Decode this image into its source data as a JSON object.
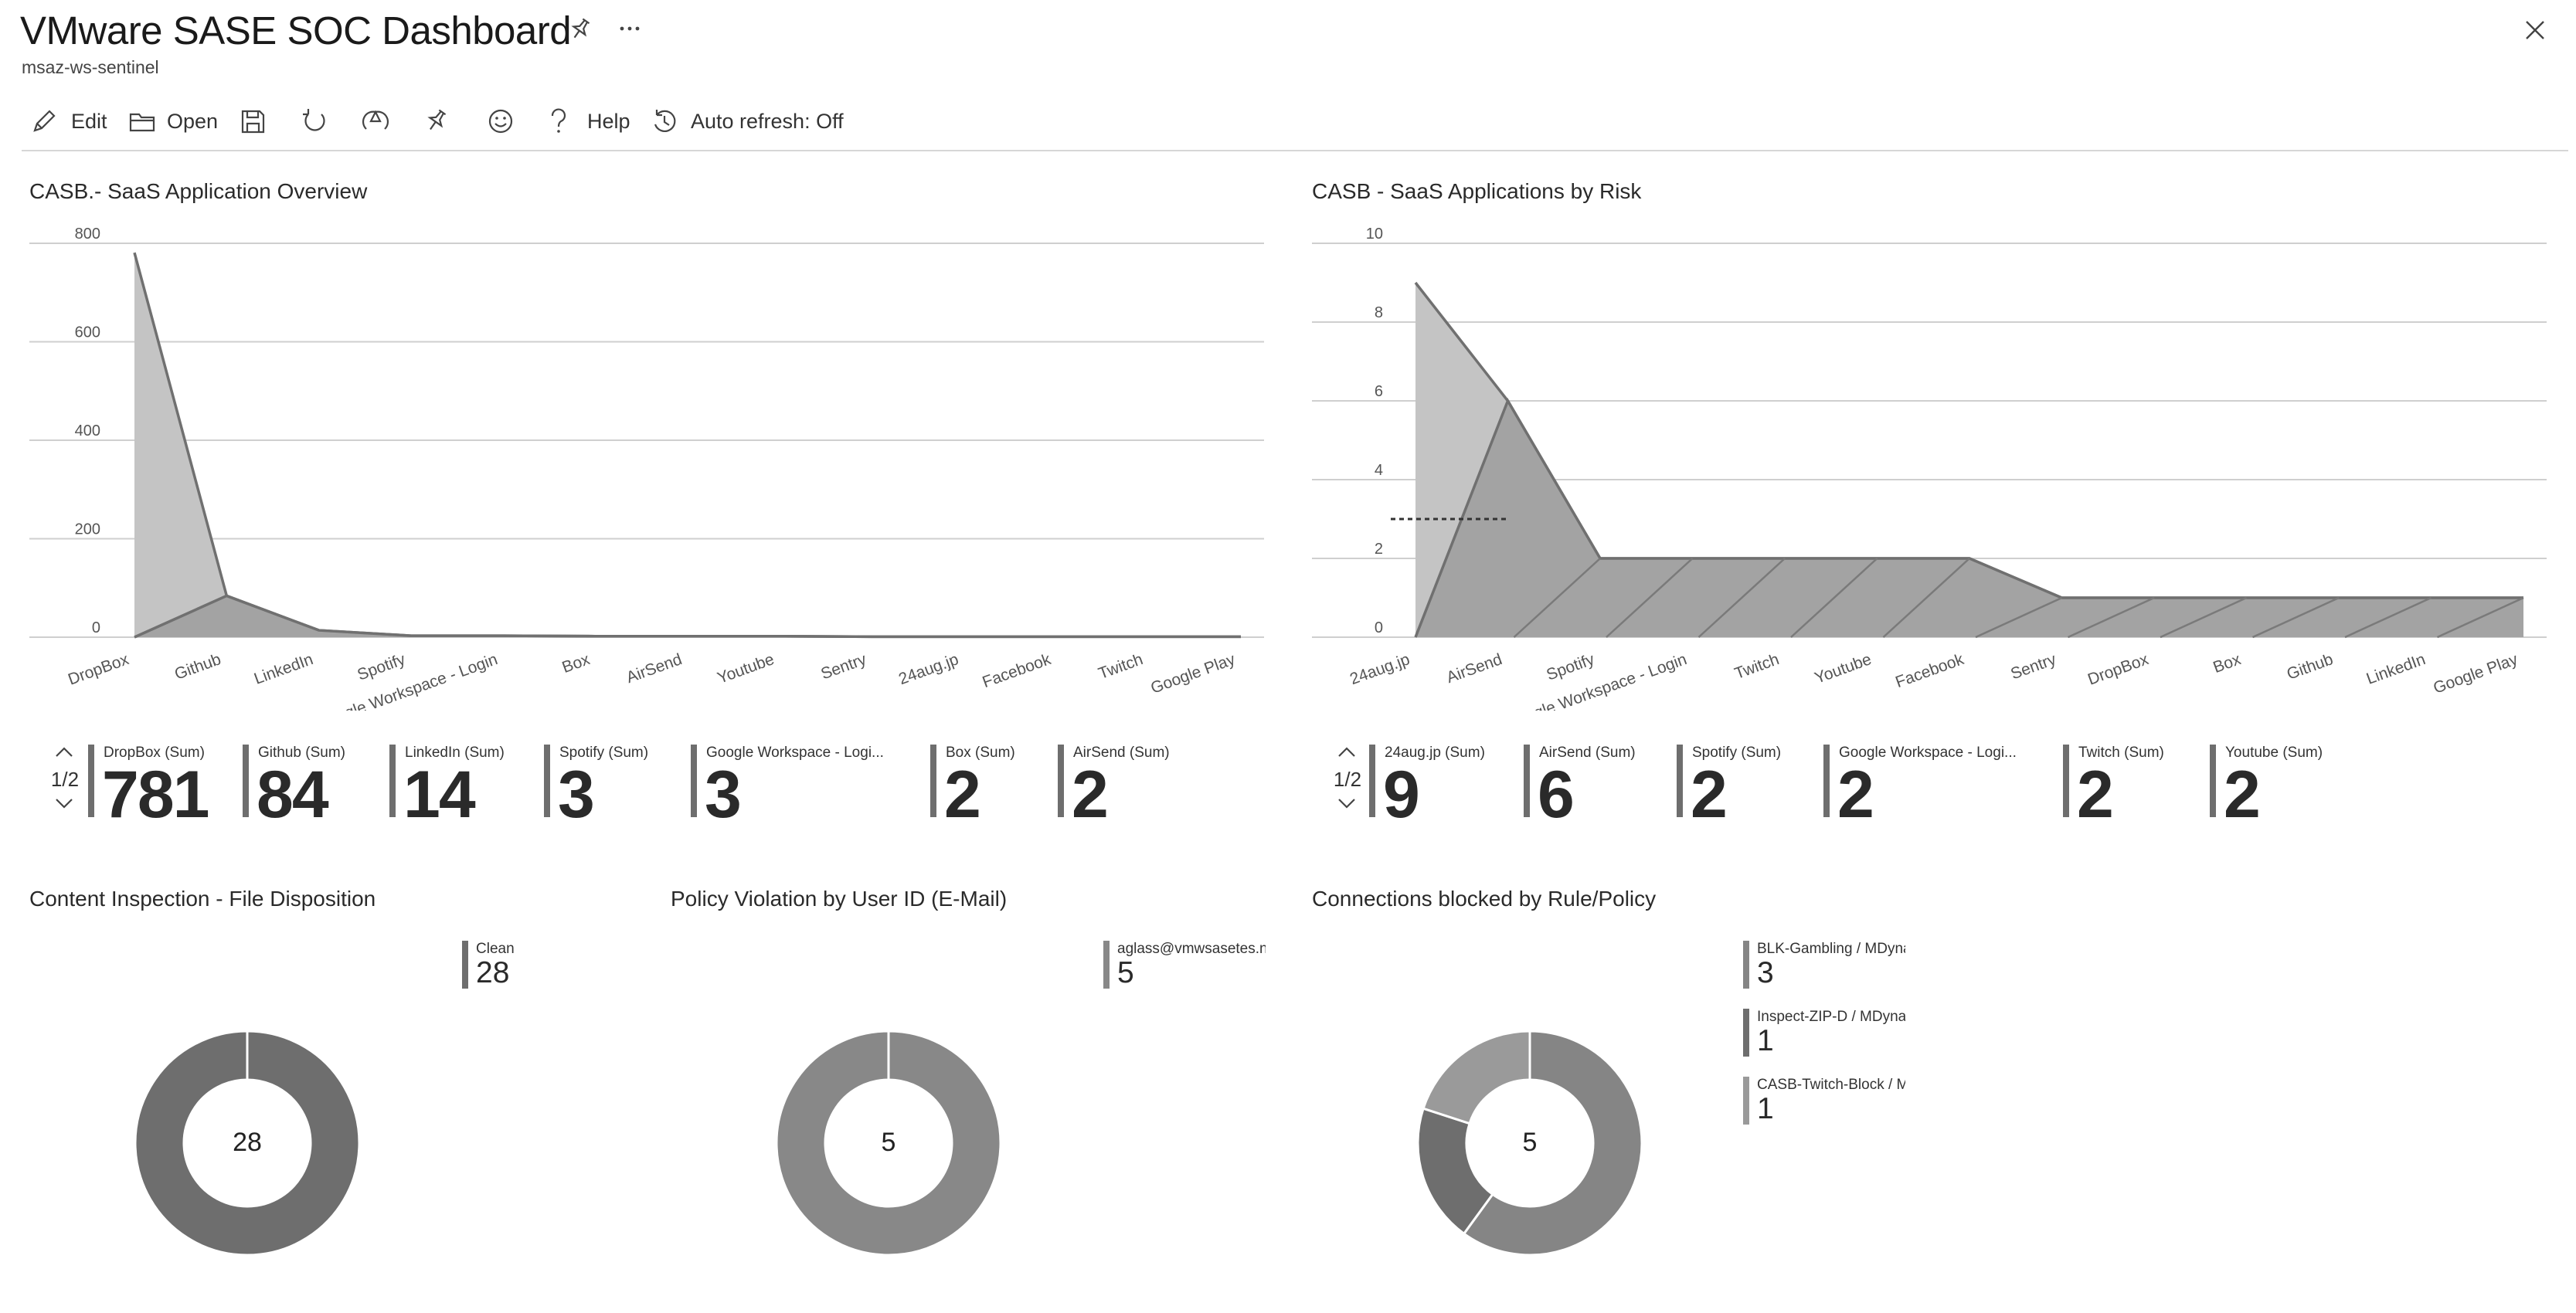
{
  "header": {
    "title": "VMware SASE SOC Dashboard",
    "subtitle": "msaz-ws-sentinel"
  },
  "toolbar": {
    "edit": "Edit",
    "open": "Open",
    "help": "Help",
    "auto_refresh": "Auto refresh: Off"
  },
  "icons": [
    "pin-icon",
    "more-icon",
    "close-icon",
    "edit-icon",
    "open-icon",
    "save-icon",
    "refresh-icon",
    "share-icon",
    "pin-icon",
    "feedback-icon",
    "help-icon",
    "history-icon"
  ],
  "chart1": {
    "title": "CASB.- SaaS Application Overview"
  },
  "chart2": {
    "title": "CASB - SaaS Applications by Risk"
  },
  "chart_data": [
    {
      "type": "area",
      "title": "CASB.- SaaS Application Overview",
      "categories": [
        "DropBox",
        "Github",
        "LinkedIn",
        "Spotify",
        "Google Workspace - Login",
        "Box",
        "AirSend",
        "Youtube",
        "Sentry",
        "24aug.jp",
        "Facebook",
        "Twitch",
        "Google Play"
      ],
      "series": [
        {
          "values": [
            781,
            84,
            14,
            3,
            3,
            2,
            2,
            2,
            1,
            1,
            1,
            1,
            1
          ]
        },
        {
          "values": [
            0,
            84,
            14,
            3,
            3,
            2,
            2,
            2,
            1,
            1,
            1,
            1,
            1
          ]
        }
      ],
      "yticks": [
        0,
        200,
        400,
        600,
        800
      ],
      "ylim": [
        0,
        800
      ]
    },
    {
      "type": "area",
      "title": "CASB - SaaS Applications by Risk",
      "categories": [
        "24aug.jp",
        "AirSend",
        "Spotify",
        "Google Workspace - Login",
        "Twitch",
        "Youtube",
        "Facebook",
        "Sentry",
        "DropBox",
        "Box",
        "Github",
        "LinkedIn",
        "Google Play"
      ],
      "series": [
        {
          "values": [
            9,
            6,
            2,
            2,
            2,
            2,
            2,
            1,
            1,
            1,
            1,
            1,
            1
          ]
        },
        {
          "values": [
            0,
            6,
            2,
            2,
            2,
            2,
            2,
            1,
            1,
            1,
            1,
            1,
            1
          ]
        }
      ],
      "yticks": [
        0,
        2,
        4,
        6,
        8,
        10
      ],
      "ylim": [
        0,
        10
      ],
      "reference_line": 3
    }
  ],
  "tiles1": {
    "pager": "1/2",
    "items": [
      {
        "label": "DropBox (Sum)",
        "value": "781"
      },
      {
        "label": "Github (Sum)",
        "value": "84"
      },
      {
        "label": "LinkedIn (Sum)",
        "value": "14"
      },
      {
        "label": "Spotify (Sum)",
        "value": "3"
      },
      {
        "label": "Google Workspace - Logi...",
        "value": "3"
      },
      {
        "label": "Box (Sum)",
        "value": "2"
      },
      {
        "label": "AirSend (Sum)",
        "value": "2"
      }
    ]
  },
  "tiles2": {
    "pager": "1/2",
    "items": [
      {
        "label": "24aug.jp (Sum)",
        "value": "9"
      },
      {
        "label": "AirSend (Sum)",
        "value": "6"
      },
      {
        "label": "Spotify (Sum)",
        "value": "2"
      },
      {
        "label": "Google Workspace - Logi...",
        "value": "2"
      },
      {
        "label": "Twitch (Sum)",
        "value": "2"
      },
      {
        "label": "Youtube (Sum)",
        "value": "2"
      }
    ]
  },
  "donut1": {
    "title": "Content Inspection - File Disposition",
    "total": "28",
    "legend": [
      {
        "label": "Clean",
        "value": "28",
        "color": "#6e6e6e"
      }
    ]
  },
  "donut2": {
    "title": "Policy Violation by User ID (E-Mail)",
    "total": "5",
    "legend": [
      {
        "label": "aglass@vmwsasetes.net",
        "value": "5",
        "color": "#888888"
      }
    ]
  },
  "donut3": {
    "title": "Connections blocked by Rule/Policy",
    "total": "5",
    "legend": [
      {
        "label": "BLK-Gambling / MDynamic",
        "value": "3",
        "color": "#858585"
      },
      {
        "label": "Inspect-ZIP-D / MDynamic",
        "value": "1",
        "color": "#6e6e6e"
      },
      {
        "label": "CASB-Twitch-Block / MDynamic",
        "value": "1",
        "color": "#9a9a9a"
      }
    ]
  }
}
